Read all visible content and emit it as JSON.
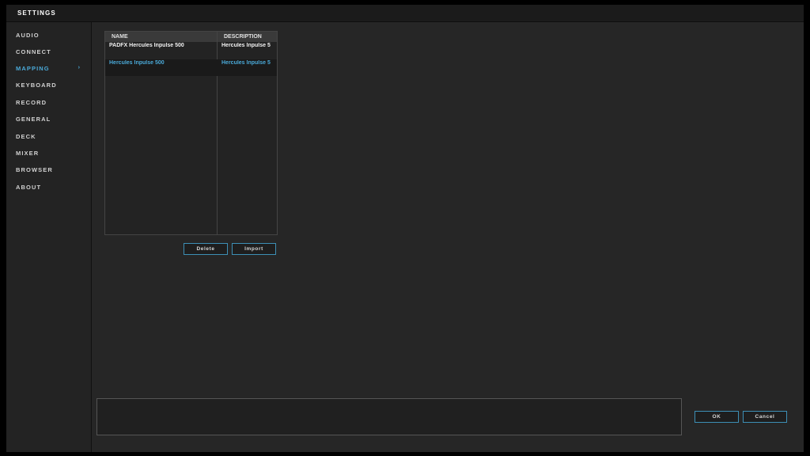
{
  "window": {
    "title": "SETTINGS"
  },
  "sidebar": {
    "items": [
      {
        "label": "AUDIO"
      },
      {
        "label": "CONNECT"
      },
      {
        "label": "MAPPING",
        "active_arrow": "›"
      },
      {
        "label": "KEYBOARD"
      },
      {
        "label": "RECORD"
      },
      {
        "label": "GENERAL"
      },
      {
        "label": "DECK"
      },
      {
        "label": "MIXER"
      },
      {
        "label": "BROWSER"
      },
      {
        "label": "ABOUT"
      }
    ],
    "active": "MAPPING"
  },
  "mapping_table": {
    "columns": [
      "NAME",
      "DESCRIPTION"
    ],
    "rows": [
      {
        "name": "PADFX Hercules Inpulse 500",
        "description": "Hercules Inpulse 5"
      },
      {
        "name": "Hercules Inpulse 500",
        "description": "Hercules Inpulse 5",
        "selected": true
      }
    ]
  },
  "actions": {
    "delete_label": "Delete",
    "import_label": "Import"
  },
  "footer": {
    "ok_label": "OK",
    "cancel_label": "Cancel"
  },
  "colors": {
    "accent": "#4aa9d8",
    "background": "#262626",
    "sidebar": "#232323"
  }
}
